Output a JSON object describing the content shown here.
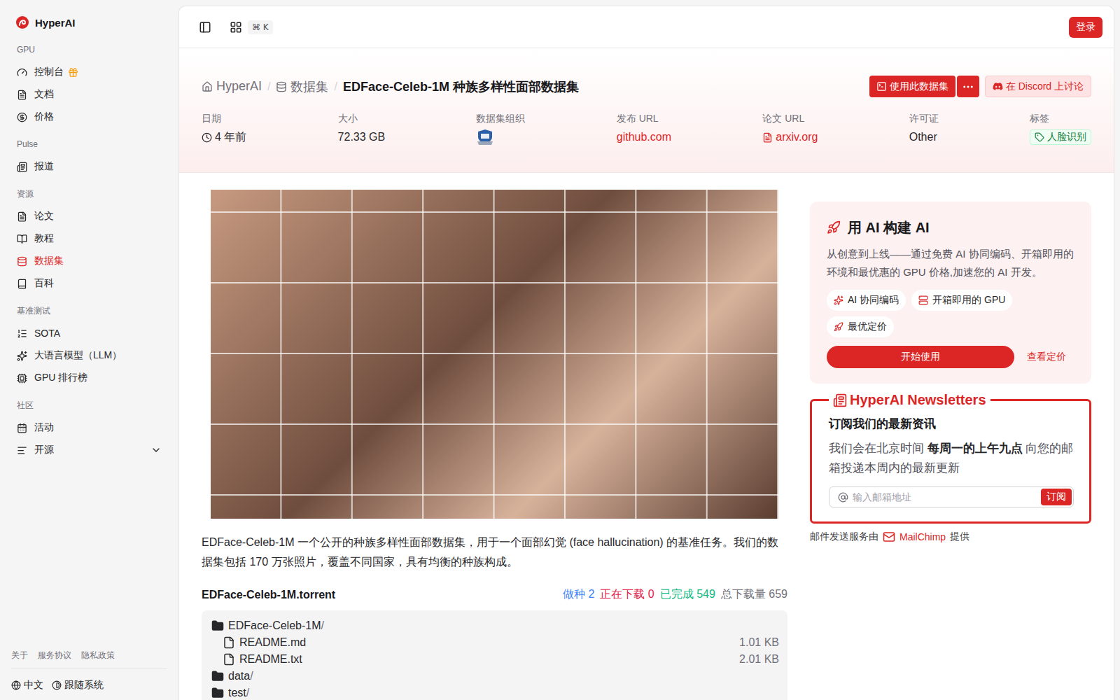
{
  "sidebar": {
    "logo": "HyperAI",
    "sections": [
      {
        "title": "GPU",
        "items": [
          {
            "label": "控制台",
            "kind": "gift",
            "selected": false
          },
          {
            "label": "文档",
            "kind": "plain",
            "selected": false
          },
          {
            "label": "价格",
            "kind": "plain",
            "selected": false
          }
        ]
      },
      {
        "title": "Pulse",
        "items": [
          {
            "label": "报道",
            "kind": "plain",
            "selected": false
          }
        ]
      },
      {
        "title": "资源",
        "items": [
          {
            "label": "论文",
            "kind": "plain",
            "selected": false
          },
          {
            "label": "教程",
            "kind": "plain",
            "selected": false
          },
          {
            "label": "数据集",
            "kind": "plain",
            "selected": true
          },
          {
            "label": "百科",
            "kind": "plain",
            "selected": false
          }
        ]
      },
      {
        "title": "基准测试",
        "items": [
          {
            "label": "SOTA",
            "kind": "plain",
            "selected": false
          },
          {
            "label": "大语言模型（LLM）",
            "kind": "plain",
            "selected": false
          },
          {
            "label": "GPU 排行榜",
            "kind": "plain",
            "selected": false
          }
        ]
      },
      {
        "title": "社区",
        "items": [
          {
            "label": "活动",
            "kind": "plain",
            "selected": false
          },
          {
            "label": "开源",
            "kind": "expand",
            "selected": false,
            "expanded": false
          }
        ]
      }
    ],
    "footer_links": [
      "关于",
      "服务协议",
      "隐私政策"
    ],
    "language": "中文",
    "theme": "跟随系统"
  },
  "topbar": {
    "shortcut": "⌘ K",
    "login": "登录"
  },
  "header": {
    "breadcrumb": [
      {
        "label": "HyperAI",
        "current": false
      },
      {
        "label": "数据集",
        "current": false
      },
      {
        "label": "EDFace-Celeb-1M 种族多样性面部数据集",
        "current": true
      }
    ],
    "separator": "/",
    "use_button": "使用此数据集",
    "discord_button": "在 Discord 上讨论",
    "meta": [
      {
        "label": "日期",
        "value": "4 年前",
        "kind": "time"
      },
      {
        "label": "大小",
        "value": "72.33 GB",
        "kind": "text"
      },
      {
        "label": "数据集组织",
        "value": "",
        "kind": "logo"
      },
      {
        "label": "发布 URL",
        "value": "github.com",
        "kind": "link"
      },
      {
        "label": "论文 URL",
        "value": "arxiv.org",
        "kind": "paper"
      },
      {
        "label": "许可证",
        "value": "Other",
        "kind": "text"
      },
      {
        "label": "标签",
        "value": "人脸识别",
        "kind": "tag"
      }
    ]
  },
  "description": "EDFace-Celeb-1M 一个公开的种族多样性面部数据集，用于一个面部幻觉 (face hallucination) 的基准任务。我们的数据集包括 170 万张照片，覆盖不同国家，具有均衡的种族构成。",
  "torrent": {
    "name": "EDFace-Celeb-1M.torrent",
    "stats": [
      {
        "label": "做种",
        "value": "2",
        "color": "#3b82f6"
      },
      {
        "label": "正在下载",
        "value": "0",
        "color": "#e11d48"
      },
      {
        "label": "已完成",
        "value": "549",
        "color": "#10b981"
      },
      {
        "label": "总下载量",
        "value": "659",
        "color": "#71717a"
      }
    ],
    "files": [
      {
        "name": "EDFace-Celeb-1M",
        "suffix": "/",
        "kind": "folder",
        "size": "",
        "children": [
          {
            "name": "README.md",
            "suffix": "",
            "kind": "file",
            "size": "1.01 KB",
            "children": []
          },
          {
            "name": "README.txt",
            "suffix": "",
            "kind": "file",
            "size": "2.01 KB",
            "children": []
          }
        ]
      },
      {
        "name": "data",
        "suffix": "/",
        "kind": "folder",
        "size": "",
        "children": []
      },
      {
        "name": "test",
        "suffix": "/",
        "kind": "folder",
        "size": "",
        "children": []
      }
    ]
  },
  "promo": {
    "title": "用 AI 构建 AI",
    "text": "从创意到上线——通过免费 AI 协同编码、开箱即用的环境和最优惠的 GPU 价格,加速您的 AI 开发。",
    "chips": [
      "AI 协同编码",
      "开箱即用的 GPU",
      "最优定价"
    ],
    "cta": "开始使用",
    "link": "查看定价"
  },
  "newsletter": {
    "legend": "HyperAI Newsletters",
    "title": "订阅我们的最新资讯",
    "text": [
      {
        "text": "我们会在北京时间 ",
        "bold": false
      },
      {
        "text": "每周一的上午九点",
        "bold": true
      },
      {
        "text": " 向您的邮箱投递本周内的最新更新",
        "bold": false
      }
    ],
    "placeholder": "输入邮箱地址",
    "button": "订阅",
    "footer": {
      "before": "邮件发送服务由",
      "brand": "MailChimp",
      "after": "提供"
    }
  }
}
